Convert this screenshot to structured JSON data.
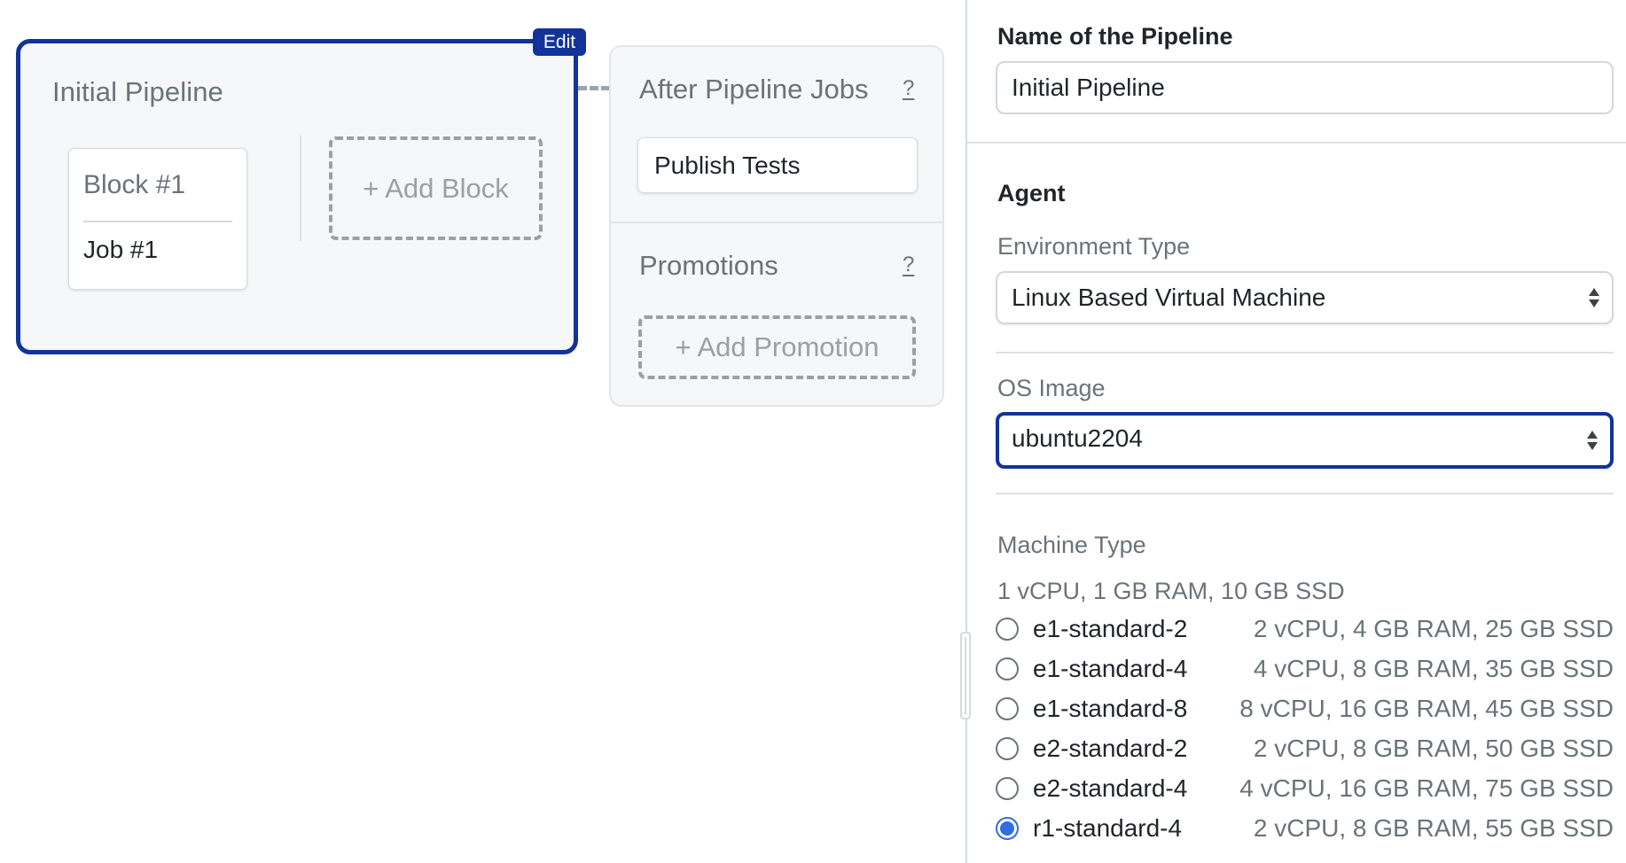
{
  "canvas": {
    "pipeline": {
      "title": "Initial Pipeline",
      "edit_label": "Edit",
      "blocks": [
        {
          "name": "Block #1",
          "jobs": [
            "Job #1"
          ]
        }
      ],
      "add_block_label": "+ Add Block"
    },
    "after_pipeline": {
      "title": "After Pipeline Jobs",
      "help": "?",
      "jobs": [
        "Publish Tests"
      ],
      "promotions_title": "Promotions",
      "promotions_help": "?",
      "add_promotion_label": "+ Add Promotion"
    }
  },
  "panel": {
    "name_label": "Name of the Pipeline",
    "name_value": "Initial Pipeline",
    "agent_heading": "Agent",
    "environment_label": "Environment Type",
    "environment_value": "Linux Based Virtual Machine",
    "os_label": "OS Image",
    "os_value": "ubuntu2204",
    "machine_label": "Machine Type",
    "machine_default_spec": "1 vCPU, 1 GB RAM, 10 GB SSD",
    "machines": [
      {
        "name": "e1-standard-2",
        "spec": "2 vCPU, 4 GB RAM, 25 GB SSD",
        "selected": false
      },
      {
        "name": "e1-standard-4",
        "spec": "4 vCPU, 8 GB RAM, 35 GB SSD",
        "selected": false
      },
      {
        "name": "e1-standard-8",
        "spec": "8 vCPU, 16 GB RAM, 45 GB SSD",
        "selected": false
      },
      {
        "name": "e2-standard-2",
        "spec": "2 vCPU, 8 GB RAM, 50 GB SSD",
        "selected": false
      },
      {
        "name": "e2-standard-4",
        "spec": "4 vCPU, 16 GB RAM, 75 GB SSD",
        "selected": false
      },
      {
        "name": "r1-standard-4",
        "spec": "2 vCPU, 8 GB RAM, 55 GB SSD",
        "selected": true
      }
    ]
  },
  "colors": {
    "accent": "#13339a",
    "radio_selected": "#2f6ce8",
    "card_background": "#f5f7f9",
    "muted_text": "#6a7378"
  }
}
